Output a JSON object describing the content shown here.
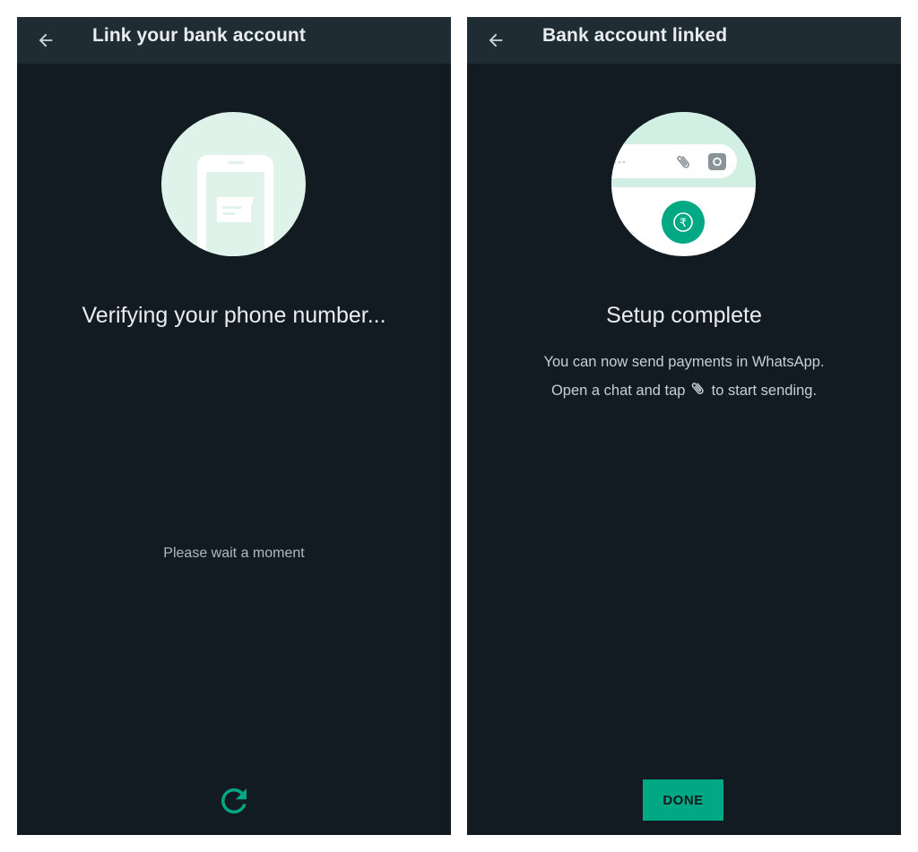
{
  "left_screen": {
    "title": "Link your bank account",
    "headline": "Verifying your phone number...",
    "subtext": "Please wait a moment",
    "icons": {
      "back": "arrow-back-icon",
      "illustration": "phone-message-illustration",
      "refresh": "refresh-icon"
    }
  },
  "right_screen": {
    "title": "Bank account linked",
    "headline": "Setup complete",
    "body_line1": "You can now send payments in WhatsApp.",
    "body_line2_before": "Open a chat and tap",
    "body_line2_after": "to start sending.",
    "done_label": "DONE",
    "rupee_symbol": "₹",
    "icons": {
      "back": "arrow-back-icon",
      "illustration": "chat-input-payment-illustration",
      "attach": "paperclip-icon",
      "camera": "camera-icon"
    }
  },
  "colors": {
    "background": "#121b22",
    "appbar": "#1f2c33",
    "accent": "#00a884",
    "illustration_circle": "#dff3ea"
  }
}
